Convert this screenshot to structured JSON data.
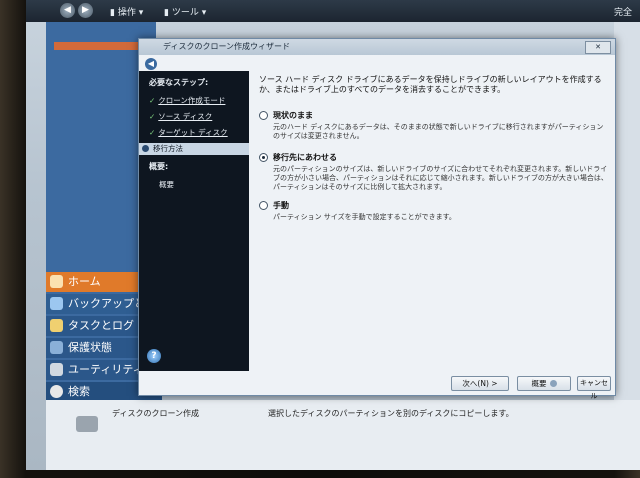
{
  "topbar": {
    "menu_action": "操作",
    "menu_tools": "ツール",
    "right_text": "完全"
  },
  "app_nav": [
    {
      "label": "ホーム",
      "icon": "home-icon"
    },
    {
      "label": "バックアップと復",
      "icon": "backup-icon"
    },
    {
      "label": "タスクとログ",
      "icon": "tasks-icon"
    },
    {
      "label": "保護状態",
      "icon": "protection-icon"
    },
    {
      "label": "ユーティリティ",
      "icon": "utility-icon"
    },
    {
      "label": "検索",
      "icon": "search-icon"
    }
  ],
  "statusbar": {
    "task_name": "ディスクのクローン作成",
    "task_desc": "選択したディスクのパーティションを別のディスクにコピーします。"
  },
  "dialog": {
    "title": "ディスクのクローン作成ウィザード",
    "sidebar": {
      "required_steps": "必要なステップ:",
      "steps": [
        "クローン作成モード",
        "ソース ディスク",
        "ターゲット ディスク"
      ],
      "active_step": "移行方法",
      "summary_head": "概要:",
      "summary_item": "概要"
    },
    "intro": "ソース ハード ディスク ドライブにあるデータを保持しドライブの新しいレイアウトを作成するか、またはドライブ上のすべてのデータを消去することができます。",
    "options": [
      {
        "title": "現状のまま",
        "desc": "元のハード ディスクにあるデータは、そのままの状態で新しいドライブに移行されますがパーティションのサイズは変更されません。",
        "selected": false
      },
      {
        "title": "移行先にあわせる",
        "desc": "元のパーティションのサイズは、新しいドライブのサイズに合わせてそれぞれ変更されます。新しいドライブの方が小さい場合、パーティションはそれに応じて縮小されます。新しいドライブの方が大きい場合は、パーティションはそのサイズに比例して拡大されます。",
        "selected": true
      },
      {
        "title": "手動",
        "desc": "パーティション サイズを手動で設定することができます。",
        "selected": false
      }
    ],
    "buttons": {
      "next": "次へ(N) >",
      "summary": "概要",
      "cancel": "キャンセル"
    }
  }
}
